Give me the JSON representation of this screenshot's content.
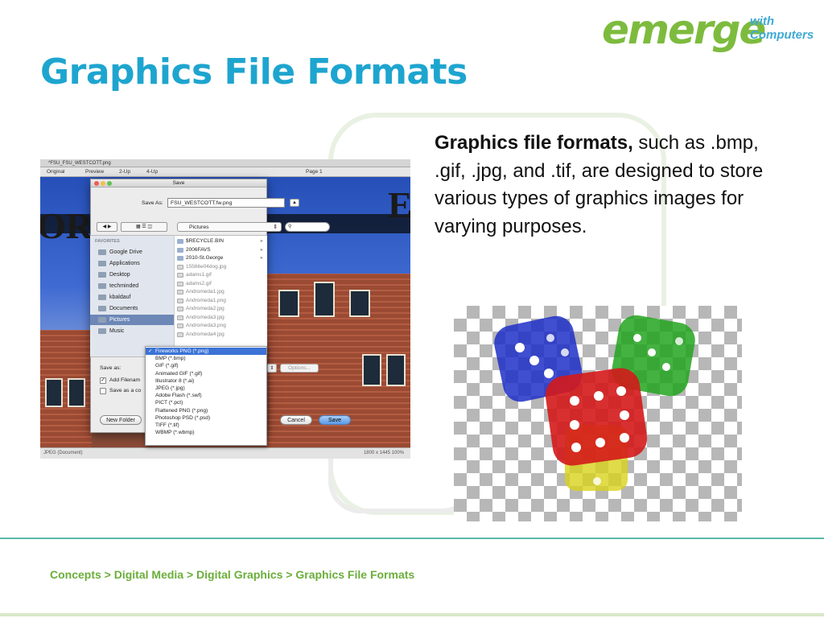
{
  "slide": {
    "title": "Graphics File Formats",
    "logo": {
      "word": "emerge",
      "line1": "with",
      "line2": "Computers"
    },
    "body": {
      "bold": "Graphics file formats,",
      "rest": " such as .bmp, .gif, .jpg, and .tif, are designed to store various types of graphics images for varying purposes."
    },
    "breadcrumb": "Concepts > Digital Media > Digital Graphics > Graphics File Formats"
  },
  "screenshot": {
    "window_title": "*FSU_FSU_WESTCOTT.png",
    "tabs": {
      "original": "Original",
      "preview": "Preview",
      "two_up": "2-Up",
      "four_up": "4-Up",
      "page": "Page 1"
    },
    "scene_text": {
      "left": "OR",
      "right": "E"
    },
    "status_left": "JPEG (Document)",
    "status_right": "1800 x 1445   100%",
    "dialog": {
      "title": "Save",
      "save_as_label": "Save As:",
      "save_as_value": "FSU_WESTCOTT.fw.png",
      "location": "Pictures",
      "sidebar_heading": "FAVORITES",
      "sidebar_items": [
        "Google Drive",
        "Applications",
        "Desktop",
        "techminded",
        "kbaldauf",
        "Documents",
        "Pictures",
        "Music"
      ],
      "files": [
        {
          "name": "$RECYCLE.BIN",
          "type": "folder"
        },
        {
          "name": "2006FAVS",
          "type": "folder"
        },
        {
          "name": "2010-St.George",
          "type": "folder"
        },
        {
          "name": "15566e04dog.jpg",
          "type": "image"
        },
        {
          "name": "adams1.gif",
          "type": "image"
        },
        {
          "name": "adams2.gif",
          "type": "image"
        },
        {
          "name": "Andromeda1.jpg",
          "type": "image"
        },
        {
          "name": "Andromeda1.png",
          "type": "image"
        },
        {
          "name": "Andromeda2.jpg",
          "type": "image"
        },
        {
          "name": "Andromeda3.jpg",
          "type": "image"
        },
        {
          "name": "Andromeda3.png",
          "type": "image"
        },
        {
          "name": "Andromeda4.jpg",
          "type": "image"
        }
      ],
      "save_as_type_label": "Save as:",
      "add_filename_label": "Add Filenam",
      "save_as_copy_label": "Save as a co",
      "options_label": "Options...",
      "new_folder_label": "New Folder",
      "cancel_label": "Cancel",
      "save_label": "Save",
      "formats": [
        "Fireworks PNG (*.png)",
        "BMP (*.bmp)",
        "GIF (*.gif)",
        "Animated GIF (*.gif)",
        "Illustrator 8 (*.ai)",
        "JPEG (*.jpg)",
        "Adobe Flash (*.swf)",
        "PICT (*.pct)",
        "Flattened PNG (*.png)",
        "Photoshop PSD (*.psd)",
        "TIFF (*.tif)",
        "WBMP (*.wbmp)"
      ]
    }
  },
  "colors": {
    "title": "#1ea5cf",
    "logo_green": "#7dbb3e",
    "logo_blue": "#3fa9d6",
    "breadcrumb": "#6aae3a",
    "footer_rule": "#5bb8a7"
  },
  "dice_image": {
    "dice_colors": [
      "#1f2fc8",
      "#22a51e",
      "#d41a1a",
      "#d8d21a"
    ]
  }
}
